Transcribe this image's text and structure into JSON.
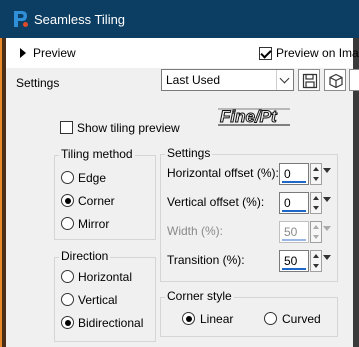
{
  "window": {
    "title": "Seamless Tiling"
  },
  "preview": {
    "label": "Preview",
    "preview_on_image_label": "Preview on Imag",
    "preview_on_image_checked": true
  },
  "settings_bar": {
    "label": "Settings",
    "preset_value": "Last Used",
    "save_icon": "save-preset-icon",
    "reset_icon": "reset-icon"
  },
  "watermark": {
    "text": "Fine/Pt"
  },
  "show_tiling_preview": {
    "label": "Show tiling preview",
    "checked": false
  },
  "tiling_method": {
    "title": "Tiling method",
    "options": [
      {
        "label": "Edge",
        "selected": false
      },
      {
        "label": "Corner",
        "selected": true
      },
      {
        "label": "Mirror",
        "selected": false
      }
    ]
  },
  "direction": {
    "title": "Direction",
    "options": [
      {
        "label": "Horizontal",
        "selected": false
      },
      {
        "label": "Vertical",
        "selected": false
      },
      {
        "label": "Bidirectional",
        "selected": true
      }
    ]
  },
  "settings_group": {
    "title": "Settings",
    "horizontal_offset": {
      "label": "Horizontal offset (%):",
      "value": "0"
    },
    "vertical_offset": {
      "label": "Vertical offset (%):",
      "value": "0"
    },
    "width": {
      "label": "Width (%):",
      "value": "50",
      "disabled": true
    },
    "transition": {
      "label": "Transition (%):",
      "value": "50"
    }
  },
  "corner_style": {
    "title": "Corner style",
    "options": [
      {
        "label": "Linear",
        "selected": true
      },
      {
        "label": "Curved",
        "selected": false
      }
    ]
  },
  "colors": {
    "titlebar": "#0c3d62",
    "accent": "#1f66c9",
    "panel": "#f0f0f0"
  }
}
